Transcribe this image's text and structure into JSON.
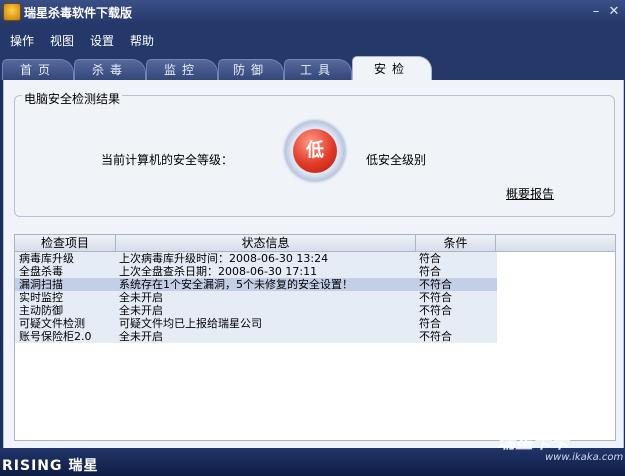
{
  "window": {
    "title": "瑞星杀毒软件下载版",
    "icon": "rising-lion-icon"
  },
  "menu": [
    "操作",
    "视图",
    "设置",
    "帮助"
  ],
  "tabs": [
    "首页",
    "杀毒",
    "监控",
    "防御",
    "工具",
    "安检"
  ],
  "active_tab": "安检",
  "check": {
    "group_title": "电脑安全检测结果",
    "level_label": "当前计算机的安全等级：",
    "level_badge": "低",
    "level_text": "低安全级别",
    "report_link": "概要报告",
    "badge_color": "#e23a27"
  },
  "table": {
    "headers": [
      "检查项目",
      "状态信息",
      "条件"
    ],
    "rows": [
      {
        "item": "病毒库升级",
        "status": "上次病毒库升级时间：2008-06-30 13:24",
        "cond": "符合"
      },
      {
        "item": "全盘杀毒",
        "status": "上次全盘查杀日期：2008-06-30 17:11",
        "cond": "符合"
      },
      {
        "item": "漏洞扫描",
        "status": "系统存在1个安全漏洞，5个未修复的安全设置！",
        "cond": "不符合"
      },
      {
        "item": "实时监控",
        "status": "全未开启",
        "cond": "不符合"
      },
      {
        "item": "主动防御",
        "status": "全未开启",
        "cond": "不符合"
      },
      {
        "item": "可疑文件检测",
        "status": "可疑文件均已上报给瑞星公司",
        "cond": "符合"
      },
      {
        "item": "账号保险柜2.0",
        "status": "全未开启",
        "cond": "不符合"
      }
    ],
    "selected_row": 2
  },
  "brand": {
    "logo": "RISING",
    "logo_cn": "瑞星"
  },
  "watermark": {
    "text": "瑞星卡卡",
    "url": "www.ikaka.com"
  }
}
